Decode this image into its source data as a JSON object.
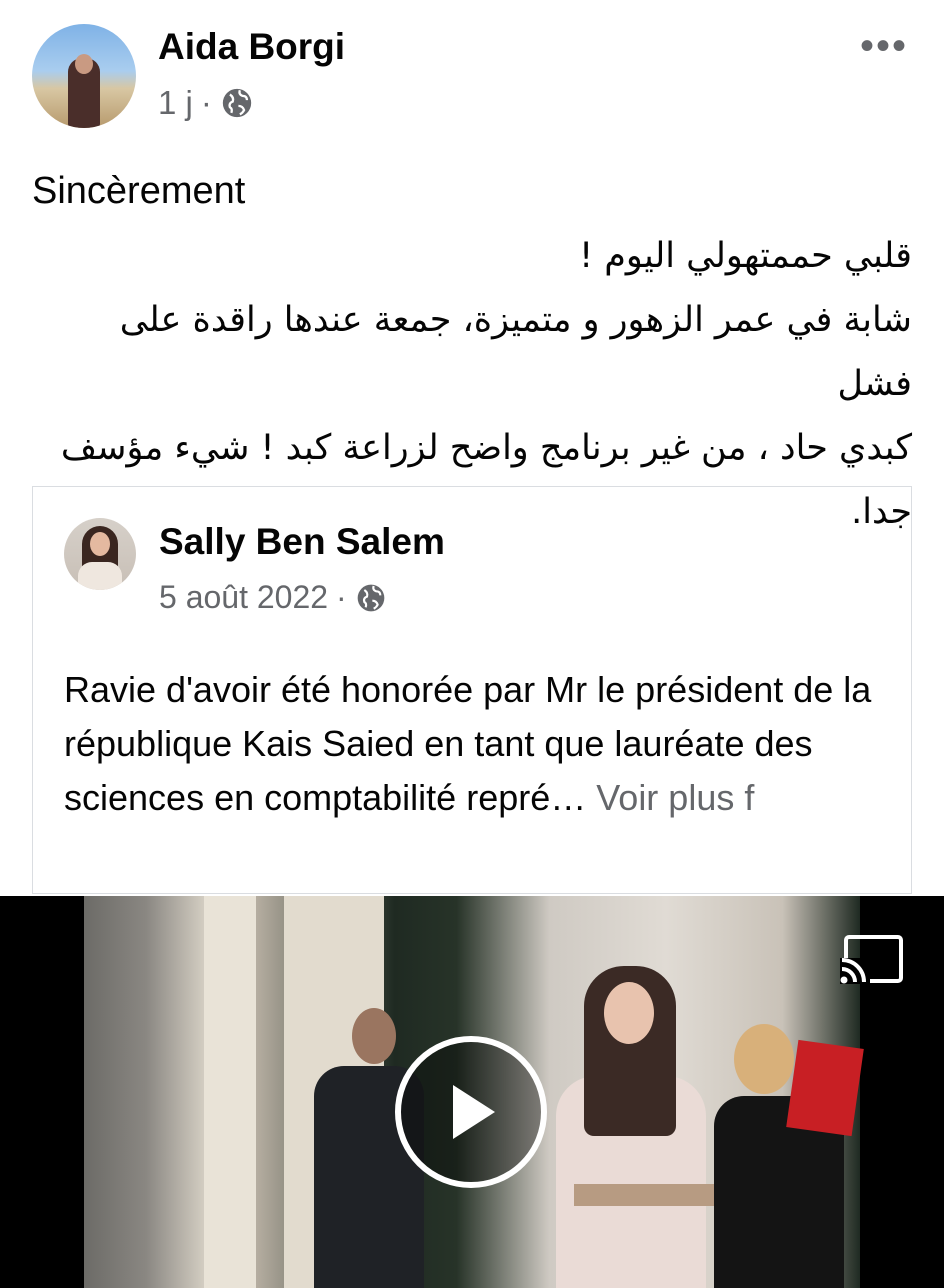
{
  "post": {
    "author": "Aida Borgi",
    "time": "1 j",
    "separator": "·",
    "privacy_icon": "globe-icon",
    "more_icon": "more-options-icon",
    "more_label": "•••",
    "caption": "Sincèrement",
    "arabic_lines": [
      "قلبي حممتهولي اليوم !",
      "شابة في عمر الزهور و متميزة، جمعة عندها راقدة على فشل",
      "كبدي حاد ، من غير برنامج واضح لزراعة كبد ! شيء مؤسف",
      "جدا."
    ]
  },
  "shared_post": {
    "author": "Sally Ben Salem",
    "date": "5 août 2022",
    "separator": "·",
    "privacy_icon": "globe-icon",
    "text": "Ravie d'avoir été honorée par Mr le président de la république Kais Saied en tant que lauréate des sciences en comptabilité repré…",
    "see_more": "Voir plus f"
  },
  "video": {
    "play_icon": "play-icon",
    "cast_icon": "cast-icon"
  }
}
